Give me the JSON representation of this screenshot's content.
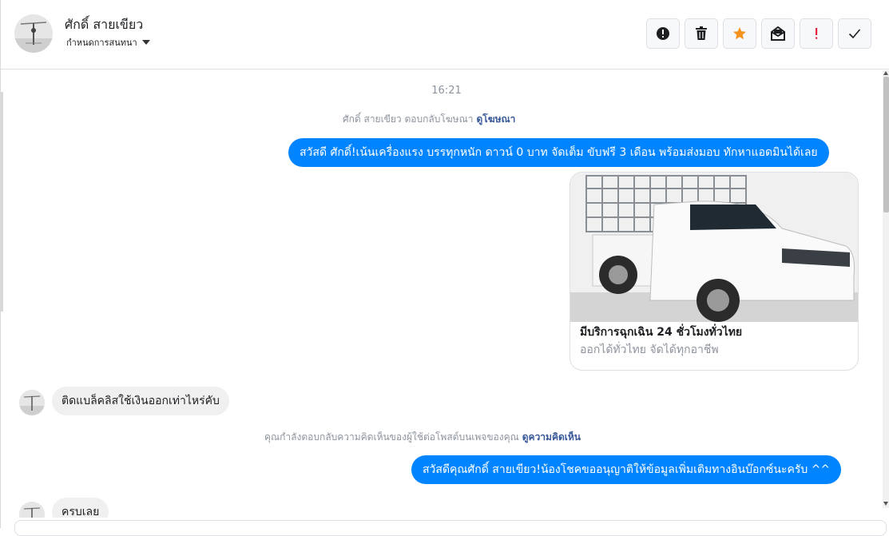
{
  "header": {
    "contact_name": "ศักดิ์ สายเขียว",
    "conversation_status": "กำหนดการสนทนา",
    "actions": [
      {
        "name": "report",
        "icon": "exclamation-circle-icon"
      },
      {
        "name": "delete",
        "icon": "trash-icon"
      },
      {
        "name": "star",
        "icon": "star-icon",
        "color": "#f5921b"
      },
      {
        "name": "mark-unread",
        "icon": "mail-icon"
      },
      {
        "name": "spam",
        "icon": "exclamation-icon",
        "color": "#e41e3f"
      },
      {
        "name": "done",
        "icon": "check-icon"
      }
    ]
  },
  "thread": {
    "timestamp": "16:21",
    "ad_reply_notice": {
      "text": "ศักดิ์ สายเขียว ตอบกลับโฆษณา",
      "link": "ดูโฆษณา"
    },
    "outgoing_1": "สวัสดี ศักดิ์!เน้นเครื่องแรง บรรทุกหนัก ดาวน์ 0 บาท จัดเต็ม ขับฟรี 3 เดือน พร้อมส่งมอบ ทักหาแอดมินได้เลย",
    "ad_card": {
      "title": "มีบริการฉุกเฉิน 24 ชั่วโมงทั่วไทย",
      "subtitle": "ออกได้ทั่วไทย จัดได้ทุกอาชีพ"
    },
    "incoming_1": "ติดแบล็คลิสใช้เงินออกเท่าไหร่คับ",
    "comment_notice": {
      "text": "คุณกำลังตอบกลับความคิดเห็นของผู้ใช้ต่อโพสต์บนเพจของคุณ",
      "link": "ดูความคิดเห็น"
    },
    "outgoing_2": "สวัสดีคุณศักดิ์ สายเขียว!น้องโชคขออนุญาติให้ข้อมูลเพิ่มเติมทางอินบ๊อกซ์นะครับ ^^",
    "incoming_2_partial": "ครบเลย"
  },
  "colors": {
    "accent": "#0084ff",
    "link": "#385898",
    "muted": "#8d949e"
  }
}
